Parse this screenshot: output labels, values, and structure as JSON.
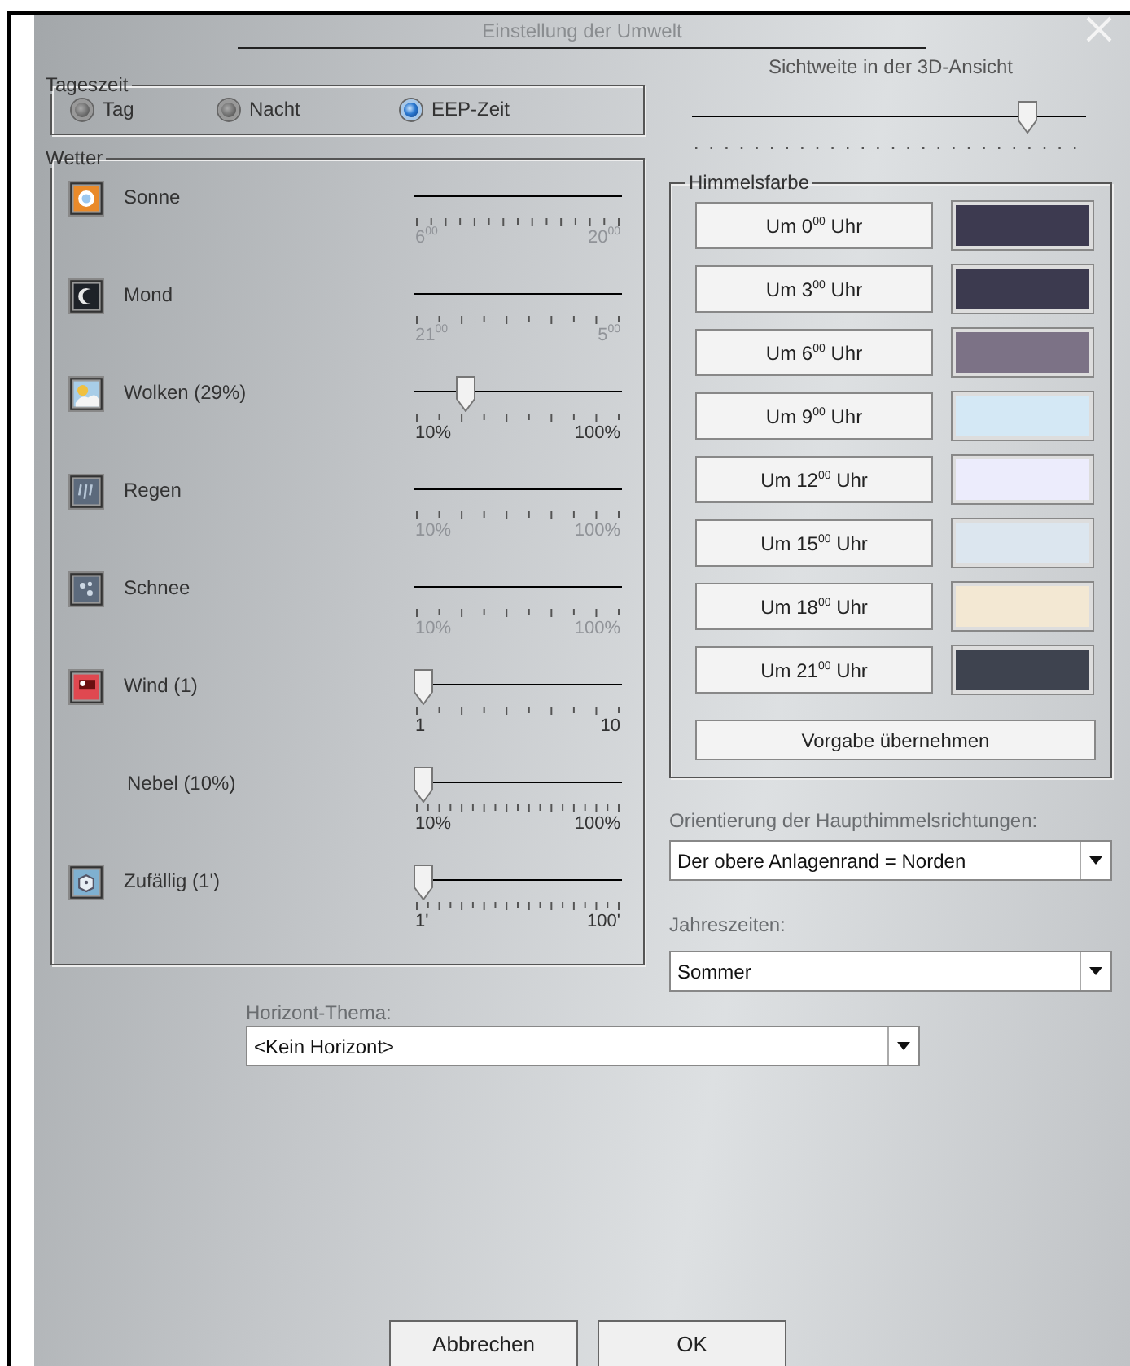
{
  "window": {
    "title": "Einstellung der Umwelt"
  },
  "tageszeit": {
    "legend": "Tageszeit",
    "options": [
      {
        "label": "Tag",
        "selected": false
      },
      {
        "label": "Nacht",
        "selected": false
      },
      {
        "label": "EEP-Zeit",
        "selected": true
      }
    ]
  },
  "sichtweite": {
    "label": "Sichtweite in der 3D-Ansicht",
    "level": 0.87
  },
  "wetter": {
    "legend": "Wetter",
    "rows": [
      {
        "label": "Sonne",
        "icon": true,
        "enabled": false,
        "kind": "medium",
        "min_label": "6$^{00}$",
        "max_label": "20$^{00}$"
      },
      {
        "label": "Mond",
        "icon": true,
        "enabled": false,
        "kind": "normal",
        "min_label": "21$^{00}$",
        "max_label": "5$^{00}$"
      },
      {
        "label": "Wolken (29%)",
        "icon": true,
        "enabled": true,
        "level": 0.22,
        "kind": "normal",
        "min_label": "10%",
        "max_label": "100%"
      },
      {
        "label": "Regen",
        "icon": true,
        "enabled": false,
        "kind": "normal",
        "min_label": "10%",
        "max_label": "100%"
      },
      {
        "label": "Schnee",
        "icon": true,
        "enabled": false,
        "kind": "normal",
        "min_label": "10%",
        "max_label": "100%"
      },
      {
        "label": "Wind (1)",
        "icon": true,
        "enabled": true,
        "level": 0,
        "kind": "normal",
        "min_label": "1",
        "max_label": "10"
      },
      {
        "label": "Nebel (10%)",
        "icon": false,
        "enabled": true,
        "level": 0,
        "kind": "dense",
        "min_label": "10%",
        "max_label": "100%"
      },
      {
        "label": "Zufällig (1')",
        "icon": true,
        "enabled": true,
        "level": 0,
        "kind": "dense",
        "min_label": "1'",
        "max_label": "100'"
      }
    ]
  },
  "himmelsfarbe": {
    "legend": "Himmelsfarbe",
    "rows": [
      {
        "label": "Um 0$^{00}$ Uhr",
        "color": "#3d3a50"
      },
      {
        "label": "Um 3$^{00}$ Uhr",
        "color": "#3c3a4f"
      },
      {
        "label": "Um 6$^{00}$ Uhr",
        "color": "#7c7286"
      },
      {
        "label": "Um 9$^{00}$ Uhr",
        "color": "#d4e8f5"
      },
      {
        "label": "Um 12$^{00}$ Uhr",
        "color": "#ececfc"
      },
      {
        "label": "Um 15$^{00}$ Uhr",
        "color": "#dce6ef"
      },
      {
        "label": "Um 18$^{00}$ Uhr",
        "color": "#f3e8d3"
      },
      {
        "label": "Um 21$^{00}$ Uhr",
        "color": "#3e434f"
      }
    ],
    "reset_button": "Vorgabe übernehmen"
  },
  "orientierung": {
    "label": "Orientierung der Haupthimmelsrichtungen:",
    "value": "Der obere Anlagenrand = Norden"
  },
  "jahreszeiten": {
    "label": "Jahreszeiten:",
    "value": "Sommer"
  },
  "horizont": {
    "label": "Horizont-Thema:",
    "value": "<Kein Horizont>"
  },
  "buttons": [
    "Abbrechen",
    "OK"
  ]
}
